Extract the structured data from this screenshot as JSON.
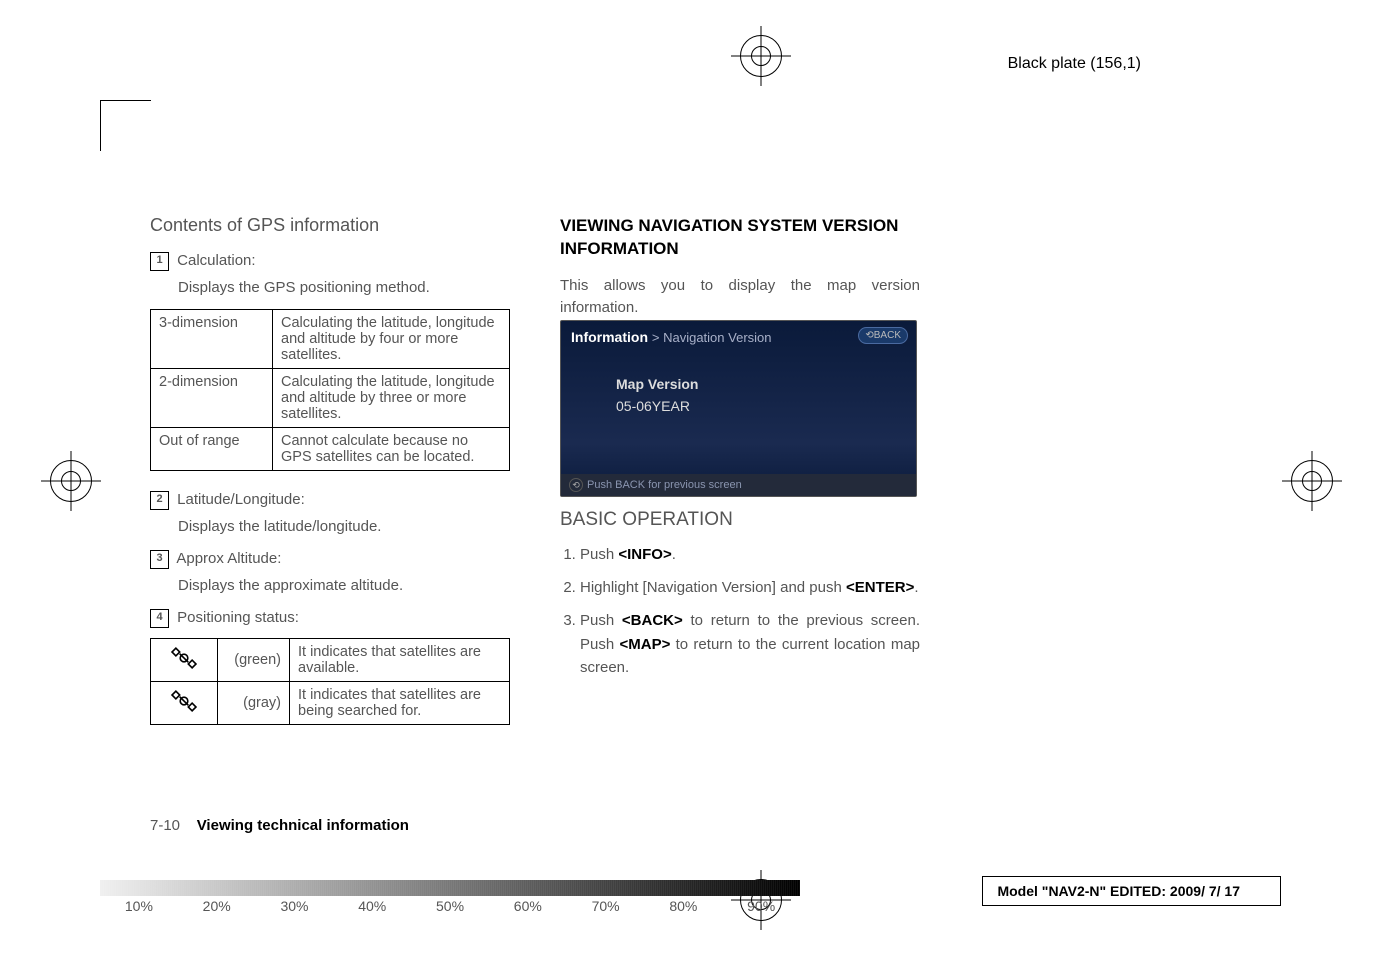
{
  "meta": {
    "black_plate": "Black plate (156,1)"
  },
  "left": {
    "heading": "Contents of GPS information",
    "calc": {
      "num": "1",
      "label": "Calculation:",
      "desc": "Displays the GPS positioning method.",
      "rows": [
        {
          "k": "3-dimension",
          "v": "Calculating the latitude, longitude and altitude by four or more satellites."
        },
        {
          "k": "2-dimension",
          "v": "Calculating the latitude, longitude and altitude by three or more satellites."
        },
        {
          "k": "Out of range",
          "v": "Cannot calculate because no GPS satellites can be located."
        }
      ]
    },
    "latlon": {
      "num": "2",
      "label": "Latitude/Longitude:",
      "desc": "Displays the latitude/longitude."
    },
    "alt": {
      "num": "3",
      "label": "Approx Altitude:",
      "desc": "Displays the approximate altitude."
    },
    "pos": {
      "num": "4",
      "label": "Positioning status:",
      "rows": [
        {
          "color": "(green)",
          "v": "It indicates that satellites are available."
        },
        {
          "color": "(gray)",
          "v": "It indicates that satellites are being searched for."
        }
      ]
    }
  },
  "right": {
    "heading": "VIEWING NAVIGATION SYSTEM VERSION INFORMATION",
    "intro": "This allows you to display the map version information.",
    "screenshot": {
      "title_bold": "Information",
      "title_rest": "> Navigation Version",
      "back": "BACK",
      "map_version_label": "Map Version",
      "map_version_value": "05-06YEAR",
      "footer": "Push BACK for previous screen"
    },
    "basic_heading": "BASIC OPERATION",
    "steps": [
      {
        "pre": "Push ",
        "b": "<INFO>",
        "post": "."
      },
      {
        "pre": "Highlight [Navigation Version] and push ",
        "b": "<ENTER>",
        "post": "."
      },
      {
        "pre": "Push ",
        "b": "<BACK>",
        "mid": " to return to the previous screen. Push ",
        "b2": "<MAP>",
        "post": " to return to the current location map screen."
      }
    ]
  },
  "footer": {
    "page_num": "7-10",
    "page_title": "Viewing technical information",
    "percents": [
      "10%",
      "20%",
      "30%",
      "40%",
      "50%",
      "60%",
      "70%",
      "80%",
      "90%"
    ],
    "model": "Model \"NAV2-N\"  EDITED: 2009/ 7/ 17"
  }
}
